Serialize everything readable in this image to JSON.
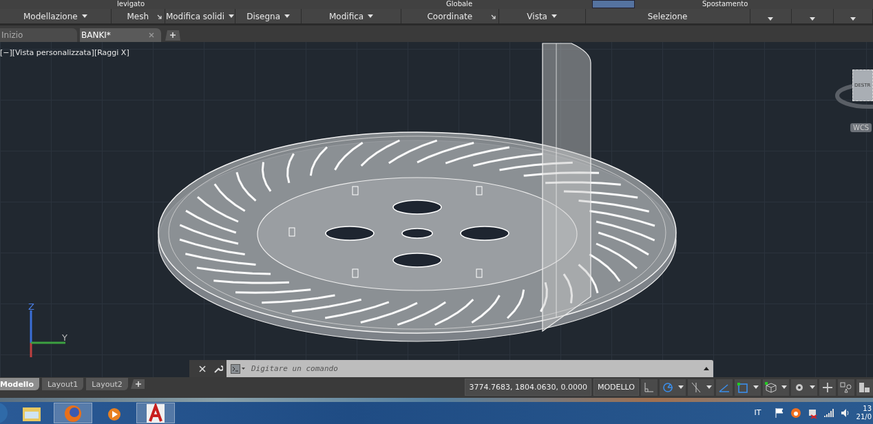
{
  "ribbon": {
    "top_row_texts": [
      "levigato",
      "Globale",
      "Spostamento"
    ],
    "panels": [
      {
        "label": "Modellazione",
        "kind": "menu"
      },
      {
        "label": "Mesh",
        "kind": "launcher"
      },
      {
        "label": "Modifica solidi",
        "kind": "menu"
      },
      {
        "label": "Disegna",
        "kind": "menu"
      },
      {
        "label": "Modifica",
        "kind": "menu"
      },
      {
        "label": "Coordinate",
        "kind": "launcher"
      },
      {
        "label": "Vista",
        "kind": "menu"
      },
      {
        "label": "Selezione",
        "kind": "plain"
      },
      {
        "kind": "menu"
      },
      {
        "kind": "menu"
      },
      {
        "kind": "menu"
      }
    ]
  },
  "file_tabs": [
    {
      "label": "Inizio",
      "selected": false,
      "closable": false
    },
    {
      "label": "BANKI*",
      "selected": true,
      "closable": true
    }
  ],
  "viewport": {
    "label": "[−][Vista personalizzata][Raggi X]",
    "viewcube_face": "DESTR",
    "ucs_button": "WCS",
    "axis_z": "Z",
    "axis_y": "Y"
  },
  "command_line": {
    "placeholder": "Digitare un comando"
  },
  "layout_tabs": [
    {
      "label": "Modello",
      "selected": true
    },
    {
      "label": "Layout1",
      "selected": false
    },
    {
      "label": "Layout2",
      "selected": false
    }
  ],
  "status_bar": {
    "coordinates": "3774.7683, 1804.0630, 0.0000",
    "space": "MODELLO",
    "toggles": [
      {
        "kind": "ortho",
        "on": false
      },
      {
        "kind": "polar",
        "on": true
      },
      {
        "kind": "caret"
      },
      {
        "kind": "isoplane",
        "on": false
      },
      {
        "kind": "caret"
      },
      {
        "kind": "tracking",
        "on": true
      },
      {
        "kind": "osnap",
        "on": true
      },
      {
        "kind": "caret"
      },
      {
        "kind": "osnap3d",
        "on": false
      },
      {
        "kind": "caret"
      },
      {
        "kind": "gear",
        "on": false
      },
      {
        "kind": "caret"
      },
      {
        "kind": "plus",
        "on": false
      },
      {
        "kind": "annotate",
        "on": false
      },
      {
        "kind": "blocks",
        "on": false
      }
    ]
  },
  "taskbar": {
    "apps": [
      {
        "kind": "folder",
        "active": false
      },
      {
        "kind": "browser",
        "active": true
      },
      {
        "kind": "media",
        "active": false
      },
      {
        "kind": "cad",
        "active": true
      }
    ],
    "language": "IT",
    "clock_time": "13",
    "clock_date": "21/0"
  }
}
